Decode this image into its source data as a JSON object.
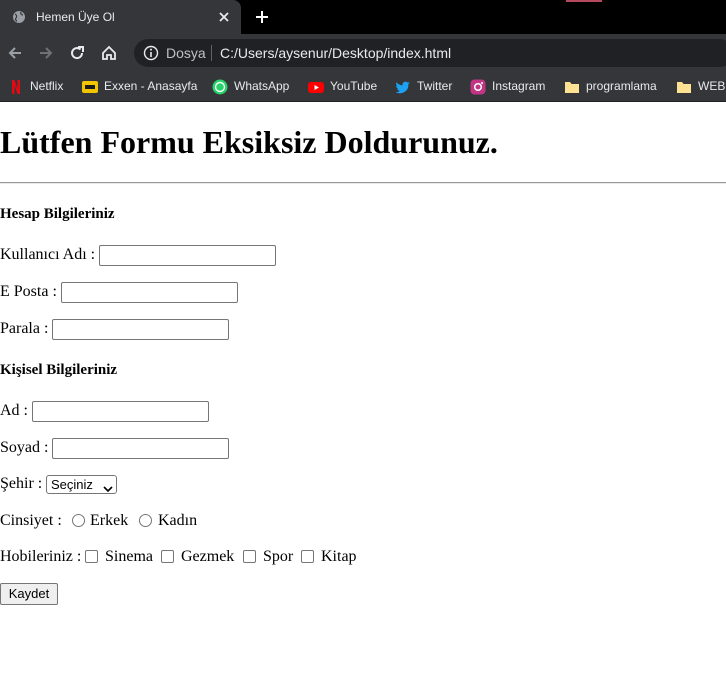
{
  "browser": {
    "tab_title": "Hemen Üye Ol",
    "address_label": "Dosya",
    "url": "C:/Users/aysenur/Desktop/index.html",
    "bookmarks": [
      {
        "label": "Netflix",
        "icon": "netflix-icon"
      },
      {
        "label": "Exxen - Anasayfa",
        "icon": "exxen-icon"
      },
      {
        "label": "WhatsApp",
        "icon": "whatsapp-icon"
      },
      {
        "label": "YouTube",
        "icon": "youtube-icon"
      },
      {
        "label": "Twitter",
        "icon": "twitter-icon"
      },
      {
        "label": "Instagram",
        "icon": "instagram-icon"
      },
      {
        "label": "programlama",
        "icon": "folder-icon"
      },
      {
        "label": "WEB",
        "icon": "folder-icon"
      }
    ],
    "colors": {
      "tabstrip": "#000000",
      "toolbar": "#35363a",
      "omnibox": "#202124"
    }
  },
  "page": {
    "heading": "Lütfen Formu Eksiksiz Doldurunuz.",
    "account_section": {
      "title": "Hesap Bilgileriniz",
      "username_label": "Kullanıcı Adı :",
      "username_value": "",
      "email_label": "E Posta :",
      "email_value": "",
      "password_label": "Parala :",
      "password_value": ""
    },
    "personal_section": {
      "title": "Kişisel Bilgileriniz",
      "first_name_label": "Ad :",
      "first_name_value": "",
      "last_name_label": "Soyad :",
      "last_name_value": "",
      "city_label": "Şehir :",
      "city_selected": "Seçiniz",
      "gender_label": "Cinsiyet :",
      "gender_options": [
        "Erkek",
        "Kadın"
      ],
      "hobbies_label": "Hobileriniz :",
      "hobbies": [
        "Sinema",
        "Gezmek",
        "Spor",
        "Kitap"
      ]
    },
    "submit_label": "Kaydet"
  }
}
